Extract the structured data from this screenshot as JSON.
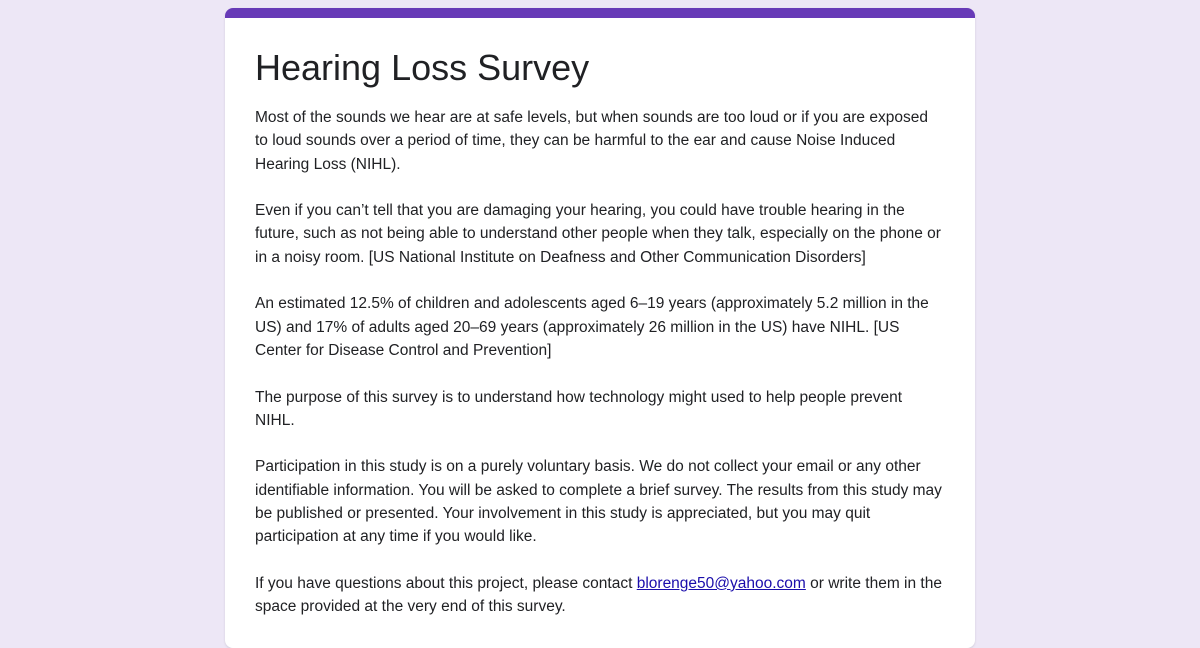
{
  "colors": {
    "background": "#ede7f6",
    "accent": "#673ab7",
    "card": "#ffffff",
    "link": "#1a0dab"
  },
  "form": {
    "title": "Hearing Loss Survey",
    "paragraphs": [
      "Most of the sounds we hear are at safe levels, but when sounds are too loud or if you are exposed to loud sounds over a period of time, they can be harmful to the ear and cause Noise Induced Hearing Loss (NIHL).",
      "Even if you can’t tell that you are damaging your hearing, you could have trouble hearing in the future, such as not being able to understand other people when they talk, especially on the phone or in a noisy room. [US National Institute on Deafness and Other Communication Disorders]",
      "An estimated 12.5% of children and adolescents aged 6–19 years (approximately 5.2 million in the US) and 17% of adults aged 20–69 years (approximately 26 million in the US) have NIHL. [US Center for Disease Control and Prevention]",
      "The purpose of this survey is to understand how technology might used to help people prevent NIHL.",
      "Participation in this study is on a purely voluntary basis. We do not collect your email or any other identifiable information. You will be asked to complete a brief survey. The results from this study may be published or presented. Your involvement in this study is appreciated, but you may quit participation at any time if you would like."
    ],
    "contact": {
      "before": "If you have questions about this project, please contact ",
      "email": "blorenge50@yahoo.com",
      "after": " or write them in the space provided at the very end of this survey."
    }
  }
}
